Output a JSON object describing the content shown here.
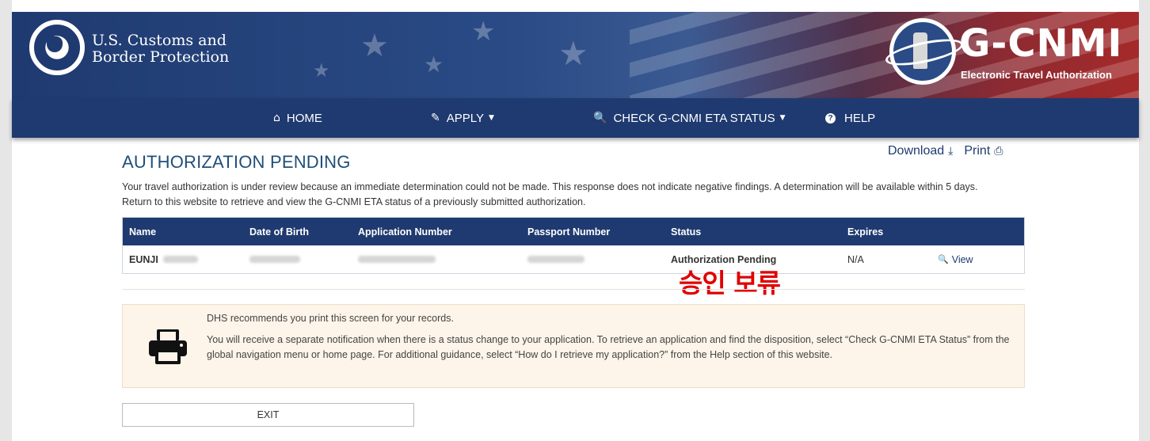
{
  "header": {
    "agency_line1": "U.S. Customs and",
    "agency_line2": "Border Protection",
    "logo_title": "G-CNMI",
    "logo_subtitle": "Electronic Travel Authorization"
  },
  "nav": {
    "items": [
      {
        "label": "HOME",
        "icon": "home-icon"
      },
      {
        "label": "APPLY",
        "icon": "pencil-icon",
        "dropdown": true
      },
      {
        "label": "CHECK G-CNMI ETA STATUS",
        "icon": "search-icon",
        "dropdown": true
      },
      {
        "label": "HELP",
        "icon": "question-circle-icon"
      }
    ]
  },
  "page": {
    "title": "AUTHORIZATION PENDING",
    "download_label": "Download",
    "print_label": "Print",
    "intro_line1": "Your travel authorization is under review because an immediate determination could not be made. This response does not indicate negative findings. A determination will be available within 5 days.",
    "intro_line2": "Return to this website to retrieve and view the G-CNMI ETA status of a previously submitted authorization."
  },
  "table": {
    "headers": [
      "Name",
      "Date of Birth",
      "Application Number",
      "Passport Number",
      "Status",
      "Expires"
    ],
    "rows": [
      {
        "name": "EUNJI",
        "status": "Authorization Pending",
        "expires": "N/A",
        "action": "View"
      }
    ]
  },
  "annotation": "승인 보류",
  "notice": {
    "line1": "DHS recommends you print this screen for your records.",
    "line2": "You will receive a separate notification when there is a status change to your application. To retrieve an application and find the disposition, select “Check G-CNMI ETA Status” from the global navigation menu or home page. For additional guidance, select “How do I retrieve my application?” from the Help section of this website."
  },
  "exit_label": "EXIT",
  "colors": {
    "navy": "#1f3a70",
    "title_blue": "#1f4e79",
    "annotation_red": "#e00000",
    "notice_bg": "#fdf4ea"
  }
}
